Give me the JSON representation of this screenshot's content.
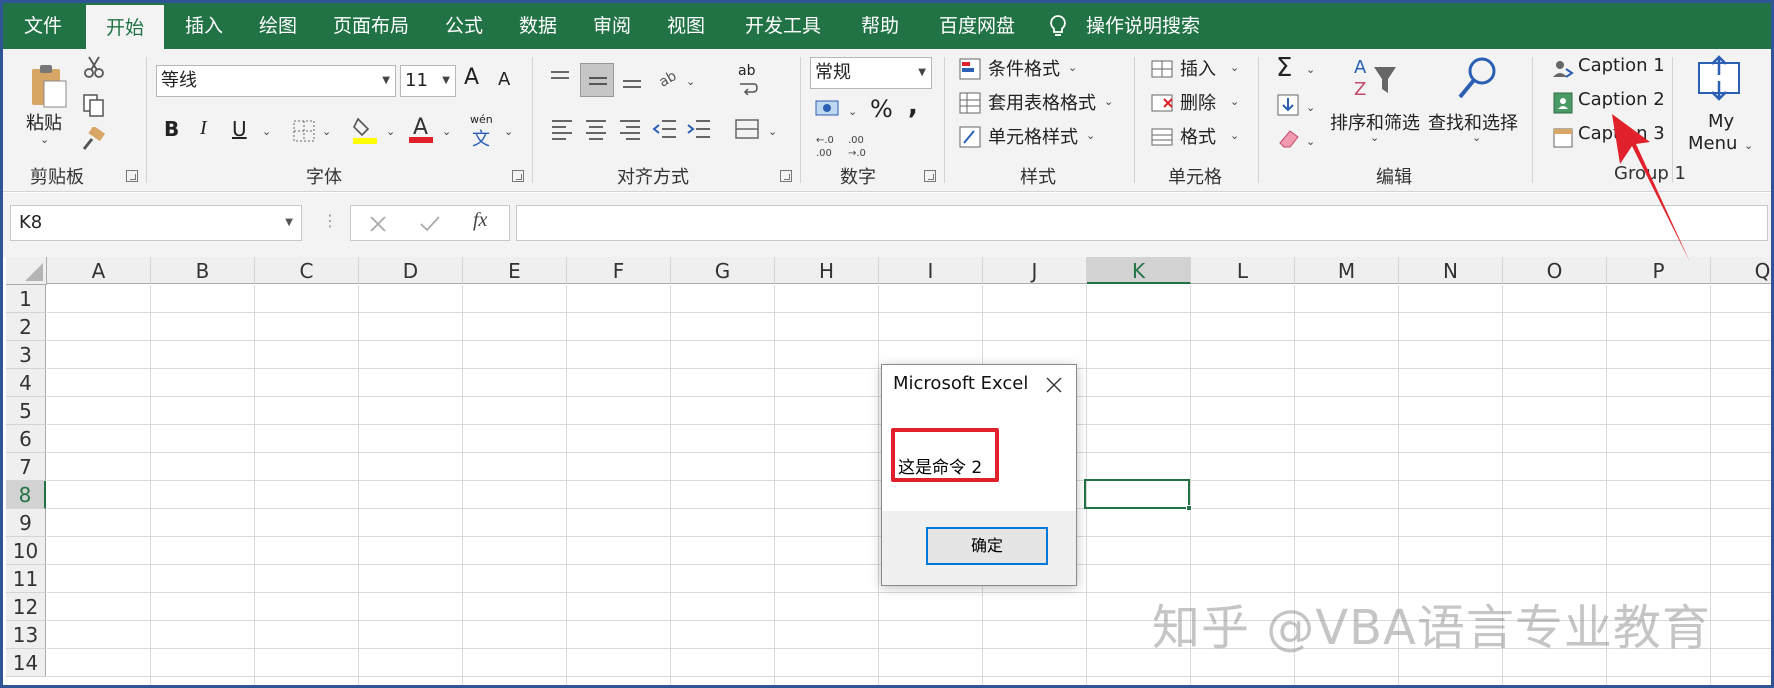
{
  "tabs": [
    "文件",
    "开始",
    "插入",
    "绘图",
    "页面布局",
    "公式",
    "数据",
    "审阅",
    "视图",
    "开发工具",
    "帮助",
    "百度网盘"
  ],
  "active_tab": "开始",
  "tell_me": "操作说明搜索",
  "ribbon": {
    "clipboard": {
      "paste": "粘贴",
      "label": "剪贴板"
    },
    "font": {
      "name": "等线",
      "size": "11",
      "label": "字体",
      "bold": "B",
      "italic": "I",
      "underline": "U",
      "grow": "A",
      "shrink": "A",
      "wen": "wén",
      "wen_char": "文"
    },
    "alignment": {
      "label": "对齐方式",
      "wrap": "ab"
    },
    "number": {
      "format": "常规",
      "label": "数字",
      "percent": "%",
      "comma": ","
    },
    "styles": {
      "cond": "条件格式",
      "table": "套用表格格式",
      "cell": "单元格样式",
      "label": "样式"
    },
    "cells": {
      "insert": "插入",
      "delete": "删除",
      "format": "格式",
      "label": "单元格"
    },
    "editing": {
      "sort": "排序和筛选",
      "find": "查找和选择",
      "label": "编辑"
    },
    "group1": {
      "caption1": "Caption 1",
      "caption2": "Caption 2",
      "caption3": "Caption 3",
      "label": "Group 1",
      "menu_line1": "My",
      "menu_line2": "Menu"
    }
  },
  "namebox": "K8",
  "formula_fx": "fx",
  "columns": [
    "A",
    "B",
    "C",
    "D",
    "E",
    "F",
    "G",
    "H",
    "I",
    "J",
    "K",
    "L",
    "M",
    "N",
    "O",
    "P",
    "Q"
  ],
  "rows": [
    "1",
    "2",
    "3",
    "4",
    "5",
    "6",
    "7",
    "8",
    "9",
    "10",
    "11",
    "12",
    "13",
    "14"
  ],
  "selected_col": "K",
  "selected_row": "8",
  "dialog": {
    "title": "Microsoft Excel",
    "message": "这是命令 2",
    "ok": "确定"
  },
  "watermark": "知乎 @VBA语言专业教育",
  "colors": {
    "excel_green": "#217346",
    "highlight_red": "#e0202a",
    "arrow_red": "#e0202a"
  }
}
